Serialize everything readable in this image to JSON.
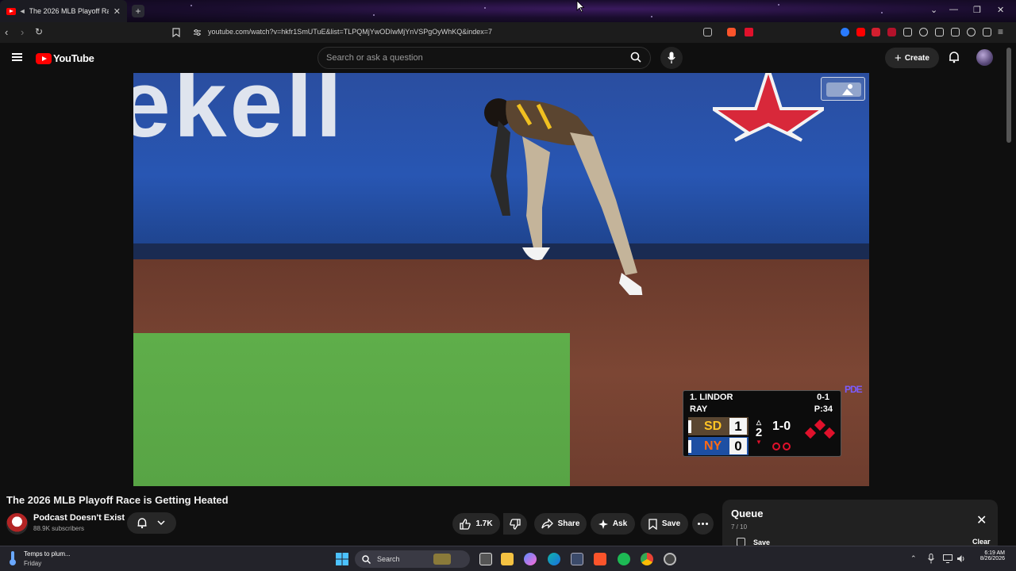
{
  "browser": {
    "tab_title": "The 2026 MLB Playoff Race is",
    "new_tab": "+",
    "tab_close": "✕",
    "url": "youtube.com/watch?v=hkfr1SmUTuE&list=TLPQMjYwODIwMjYnVSPgOyWhKQ&index=7",
    "window_controls": [
      "⌄",
      "—",
      "❐",
      "✕"
    ]
  },
  "youtube": {
    "logo_text": "YouTube",
    "search_placeholder": "Search or ask a question",
    "create_label": "Create"
  },
  "scorebug": {
    "batter": "1. LINDOR",
    "count_label": "0-1",
    "pitcher": "RAY",
    "pitch_count": "P:34",
    "teams": [
      {
        "abbr": "SD",
        "logo": "SD",
        "score": "1",
        "color": "#5a4631"
      },
      {
        "abbr": "NYM",
        "logo": "NY",
        "score": "0",
        "color": "#1d4fa3"
      }
    ],
    "inning": "2",
    "score_count": "1-0",
    "outs": 2
  },
  "video": {
    "title": "The 2026 MLB Playoff Race is Getting Heated",
    "watermark": "PDE",
    "ad_text": "ekell"
  },
  "channel": {
    "name": "Podcast Doesn't Exist",
    "subscribers": "88.9K subscribers"
  },
  "actions": {
    "like_count": "1.7K",
    "share": "Share",
    "ask": "Ask",
    "save": "Save"
  },
  "queue": {
    "title": "Queue",
    "position": "7 / 10",
    "save": "Save",
    "clear": "Clear",
    "close": "✕"
  },
  "taskbar": {
    "weather_text": "Temps to plum...",
    "day": "Friday",
    "search": "Search",
    "time": "6:19 AM",
    "date": "8/26/2026"
  },
  "colors": {
    "youtube_red": "#ff0000",
    "accent_red": "#e0112b"
  }
}
